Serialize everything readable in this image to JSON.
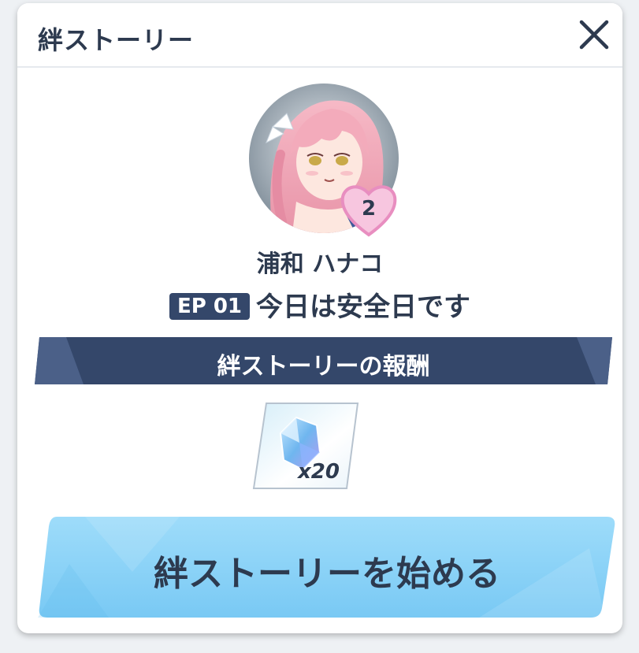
{
  "dialog": {
    "title": "絆ストーリー",
    "close_icon": "close-icon"
  },
  "character": {
    "bond_level": "2",
    "name": "浦和 ハナコ"
  },
  "episode": {
    "badge": "EP 01",
    "title": "今日は安全日です"
  },
  "reward": {
    "banner_label": "絆ストーリーの報酬",
    "item_icon": "crystal-icon",
    "quantity": "x20"
  },
  "action": {
    "start_label": "絆ストーリーを始める"
  },
  "colors": {
    "text_dark": "#2d3a4f",
    "banner_navy": "#34476a",
    "button_blue": "#8fd4f7",
    "heart_pink": "#f4b6d9"
  }
}
